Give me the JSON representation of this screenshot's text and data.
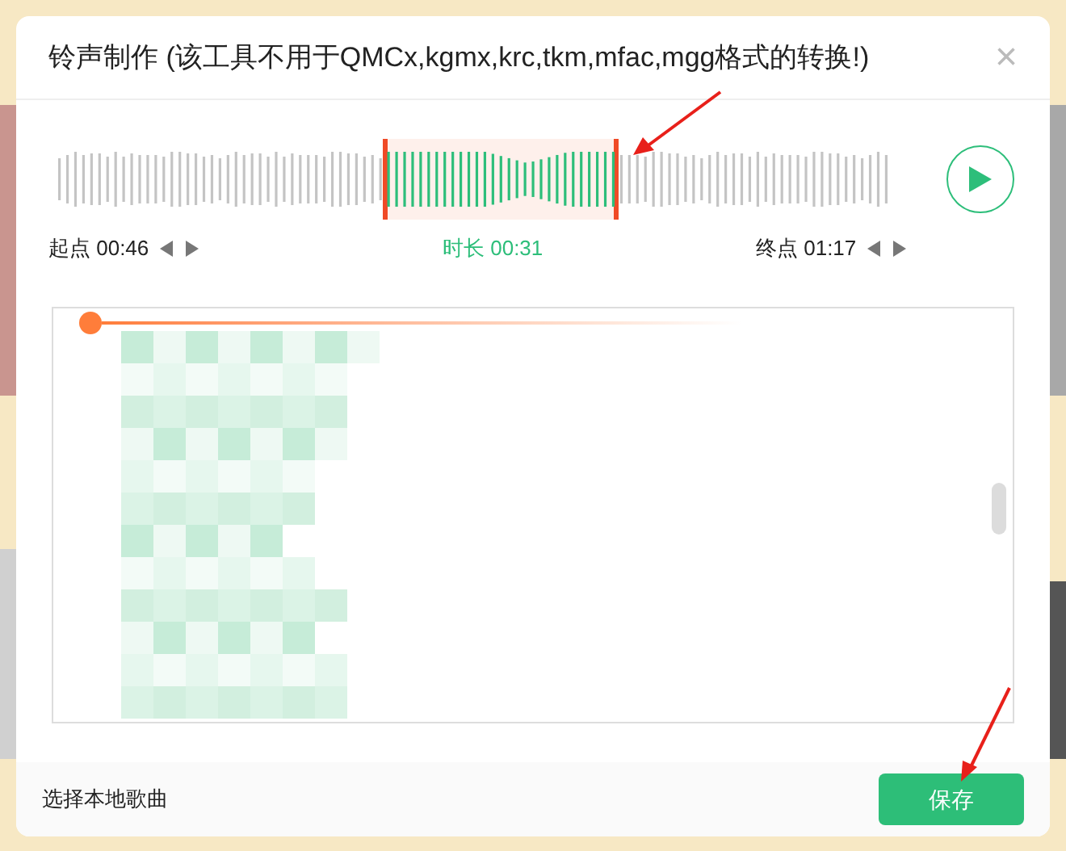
{
  "dialog": {
    "title": "铃声制作 (该工具不用于QMCx,kgmx,krc,tkm,mfac,mgg格式的转换!)",
    "close": "×"
  },
  "times": [
    {
      "kind": "start",
      "label": "起点",
      "value": "00:46"
    },
    {
      "kind": "duration",
      "label": "时长",
      "value": "00:31"
    },
    {
      "kind": "end",
      "label": "终点",
      "value": "01:17"
    }
  ],
  "footer": {
    "link": "选择本地歌曲",
    "button": "保存"
  }
}
